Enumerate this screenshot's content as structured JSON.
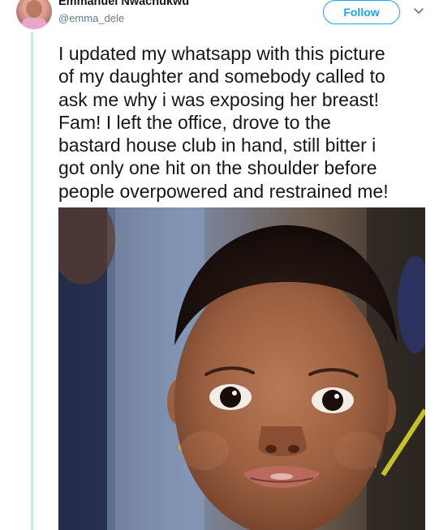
{
  "user": {
    "name": "Emmanuel Nwachukwu",
    "handle": "@emma_dele"
  },
  "actions": {
    "follow_label": "Follow"
  },
  "icons": {
    "more": "chevron-down-icon"
  },
  "tweet": {
    "text_lines": [
      "I updated my whatsapp with this picture",
      "of my daughter and somebody called to",
      "ask me why i was exposing her breast!",
      "Fam! I left the office, drove to the",
      "bastard house club in hand, still bitter i",
      "got only one hit on the shoulder before",
      "people overpowered and restrained me!"
    ]
  },
  "colors": {
    "accent": "#1da1f2",
    "name": "#14171a",
    "handle": "#657786",
    "thread_line": "#c4e6f8"
  }
}
